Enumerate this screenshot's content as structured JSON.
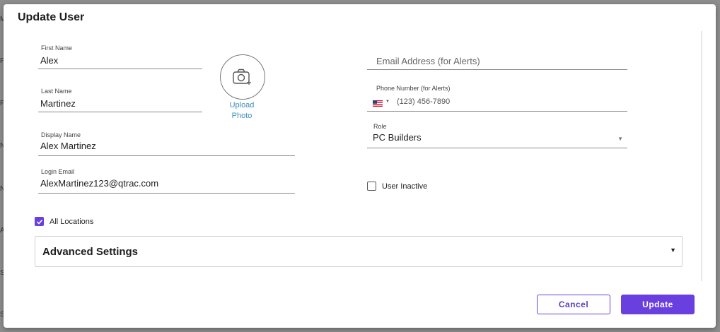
{
  "background_letters": [
    "M",
    "P",
    "P",
    "N",
    "N",
    "A",
    "S",
    "S"
  ],
  "dialog": {
    "title": "Update User"
  },
  "form": {
    "first_name": {
      "label": "First Name",
      "value": "Alex"
    },
    "last_name": {
      "label": "Last Name",
      "value": "Martinez"
    },
    "display_name": {
      "label": "Display Name",
      "value": "Alex Martinez"
    },
    "login_email": {
      "label": "Login Email",
      "value": "AlexMartinez123@qtrac.com"
    },
    "upload_photo": {
      "line1": "Upload",
      "line2": "Photo"
    },
    "email_alerts": {
      "placeholder": "Email Address (for Alerts)"
    },
    "phone_alerts": {
      "label": "Phone Number (for Alerts)",
      "placeholder": "(123) 456-7890",
      "country_flag": "us-flag-icon"
    },
    "role": {
      "label": "Role",
      "value": "PC Builders"
    },
    "user_inactive": {
      "label": "User Inactive",
      "checked": false
    },
    "all_locations": {
      "label": "All Locations",
      "checked": true
    }
  },
  "advanced_settings": {
    "title": "Advanced Settings"
  },
  "buttons": {
    "cancel": "Cancel",
    "update": "Update"
  },
  "colors": {
    "accent": "#6a3fe0",
    "link": "#3c8fb5",
    "overlay": "#8e8e8e"
  }
}
